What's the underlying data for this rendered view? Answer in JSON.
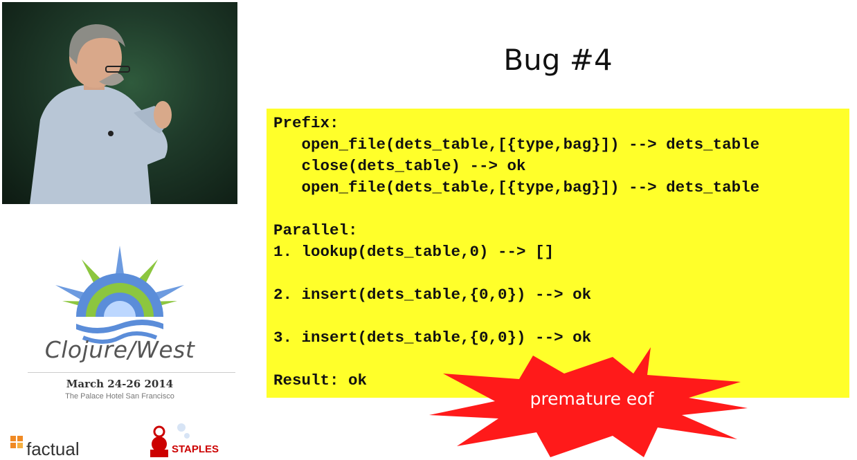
{
  "sidebar": {
    "conference_name": "Clojure/West",
    "date": "March 24-26 2014",
    "venue": "The Palace Hotel San Francisco",
    "sponsors": [
      {
        "name": "factual"
      },
      {
        "name": "STAPLES"
      }
    ]
  },
  "slide": {
    "title": "Bug #4",
    "code_lines": [
      "Prefix:",
      "   open_file(dets_table,[{type,bag}]) --> dets_table",
      "   close(dets_table) --> ok",
      "   open_file(dets_table,[{type,bag}]) --> dets_table",
      "",
      "Parallel:",
      "1. lookup(dets_table,0) --> []",
      "",
      "2. insert(dets_table,{0,0}) --> ok",
      "",
      "3. insert(dets_table,{0,0}) --> ok",
      "",
      "Result: ok"
    ],
    "burst_text": "premature eof",
    "colors": {
      "code_background": "#ffff2a",
      "burst": "#ff1a1a"
    }
  }
}
